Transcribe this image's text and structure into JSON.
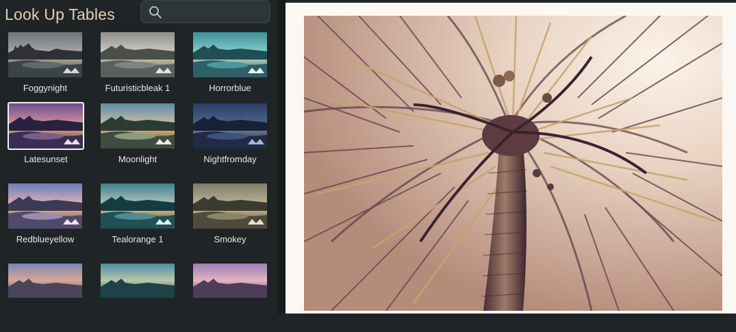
{
  "panel": {
    "title": "Look Up Tables",
    "search": {
      "placeholder": "",
      "value": ""
    }
  },
  "luts": [
    {
      "label": "Foggynight",
      "selected": false
    },
    {
      "label": "Futuristicbleak 1",
      "selected": false
    },
    {
      "label": "Horrorblue",
      "selected": false
    },
    {
      "label": "Latesunset",
      "selected": true
    },
    {
      "label": "Moonlight",
      "selected": false
    },
    {
      "label": "Nightfromday",
      "selected": false
    },
    {
      "label": "Redblueyellow",
      "selected": false
    },
    {
      "label": "Tealorange 1",
      "selected": false
    },
    {
      "label": "Smokey",
      "selected": false
    },
    {
      "label": "",
      "selected": false
    },
    {
      "label": "",
      "selected": false
    },
    {
      "label": "",
      "selected": false
    }
  ],
  "icons": {
    "search": "search-icon"
  },
  "colors": {
    "accent": "#e7cdb4",
    "panel_bg": "#1f2526",
    "preview_bg": "#fbf8f3"
  }
}
